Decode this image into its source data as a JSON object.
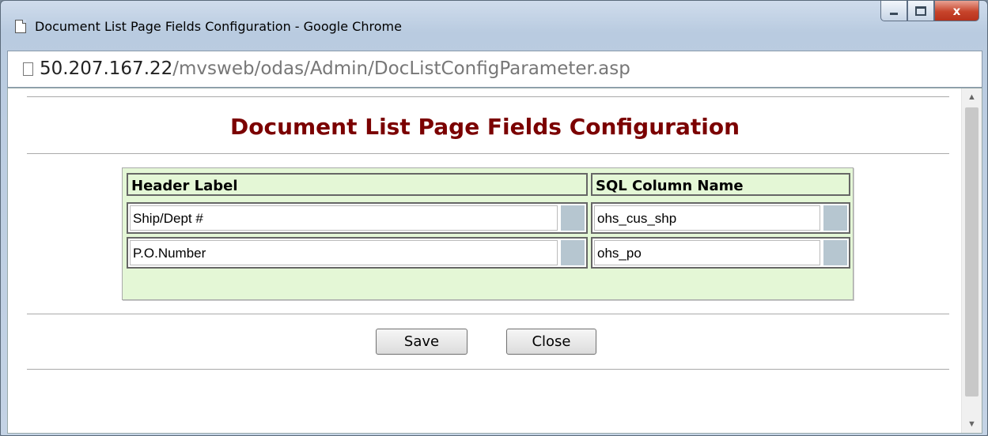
{
  "window": {
    "title": "Document List Page Fields Configuration - Google Chrome",
    "close_glyph": "x"
  },
  "address": {
    "host": "50.207.167.22",
    "path": "/mvsweb/odas/Admin/DocListConfigParameter.asp"
  },
  "page": {
    "title": "Document List Page Fields Configuration"
  },
  "table": {
    "headers": [
      "Header Label",
      "SQL Column Name"
    ],
    "rows": [
      {
        "label": "Ship/Dept #",
        "column": "ohs_cus_shp"
      },
      {
        "label": "P.O.Number",
        "column": "ohs_po"
      }
    ]
  },
  "buttons": {
    "save": "Save",
    "close": "Close"
  },
  "colors": {
    "title": "#7b0000",
    "table_bg": "#e4f7d6",
    "grip": "#b6c6d0"
  }
}
